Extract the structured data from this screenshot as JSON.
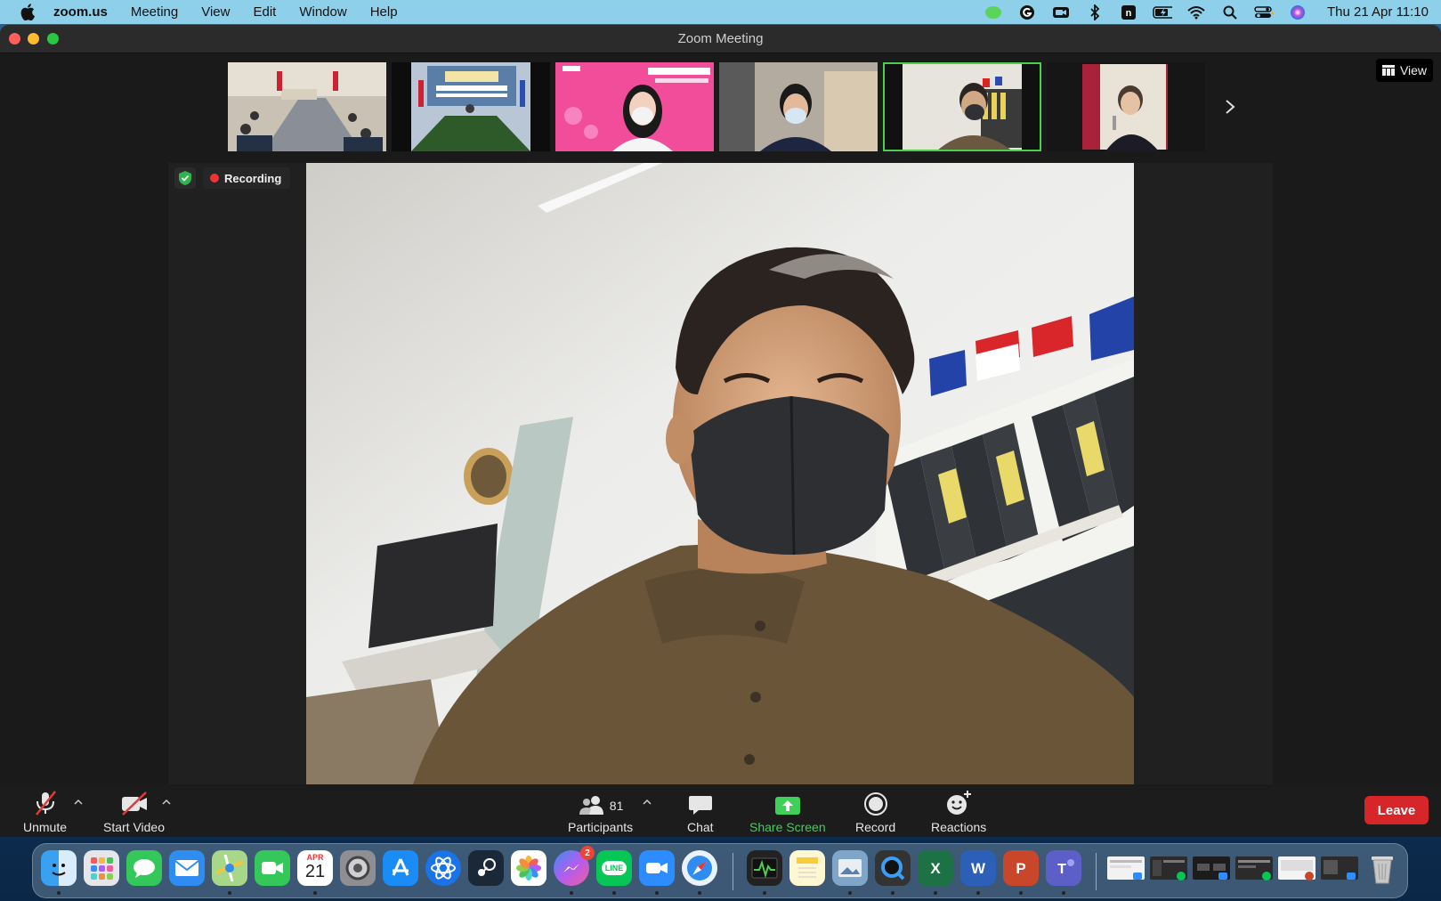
{
  "menubar": {
    "app_name": "zoom.us",
    "items": [
      "Meeting",
      "View",
      "Edit",
      "Window",
      "Help"
    ],
    "clock": "Thu 21 Apr  11:10"
  },
  "window": {
    "title": "Zoom Meeting"
  },
  "view_button": {
    "label": "View"
  },
  "meeting": {
    "recording_label": "Recording"
  },
  "controls": {
    "unmute": "Unmute",
    "start_video": "Start Video",
    "participants": "Participants",
    "participants_count": "81",
    "chat": "Chat",
    "share_screen": "Share Screen",
    "record": "Record",
    "reactions": "Reactions",
    "leave": "Leave"
  },
  "dock": {
    "calendar_month": "APR",
    "calendar_day": "21",
    "messenger_badge": "2",
    "line_label": "LINE"
  },
  "colors": {
    "accent_green": "#3fd05a",
    "leave_red": "#d7262a",
    "recording_red": "#e33333",
    "menubar_bg": "#8ed0ea"
  }
}
